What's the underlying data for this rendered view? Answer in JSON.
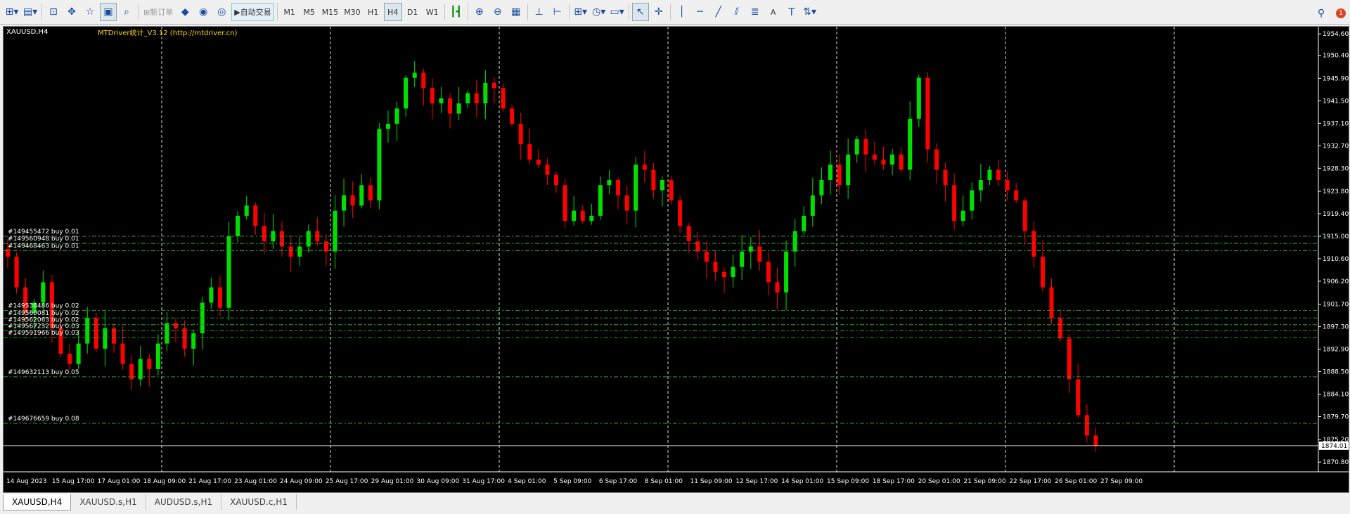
{
  "toolbar": {
    "new_order": "新订单",
    "auto_trading": "自动交易",
    "timeframes": [
      "M1",
      "M5",
      "M15",
      "M30",
      "H1",
      "H4",
      "D1",
      "W1"
    ],
    "active_timeframe": "H4",
    "text_tool": "A",
    "notification_count": "1"
  },
  "chart": {
    "symbol_label": "XAUUSD,H4",
    "indicator_label": "MTDriver统计_V3.12 (http://mtdriver.cn)",
    "current_price": "1874.01",
    "colors": {
      "bull": "#00e000",
      "bear": "#ff0000",
      "level": "#2aa02a",
      "grid": "#ffffff"
    }
  },
  "chart_data": {
    "type": "candlestick",
    "symbol": "XAUUSD",
    "timeframe": "H4",
    "price_axis": [
      "1954.60",
      "1950.40",
      "1945.90",
      "1941.50",
      "1937.10",
      "1932.70",
      "1928.30",
      "1923.80",
      "1919.40",
      "1915.00",
      "1910.60",
      "1906.20",
      "1901.70",
      "1897.30",
      "1892.90",
      "1888.50",
      "1884.10",
      "1879.70",
      "1875.20",
      "1870.80"
    ],
    "time_axis": [
      "14 Aug 2023",
      "15 Aug 17:00",
      "17 Aug 01:00",
      "18 Aug 09:00",
      "21 Aug 17:00",
      "23 Aug 01:00",
      "24 Aug 09:00",
      "25 Aug 17:00",
      "29 Aug 01:00",
      "30 Aug 09:00",
      "31 Aug 17:00",
      "4 Sep 01:00",
      "5 Sep 09:00",
      "6 Sep 17:00",
      "8 Sep 01:00",
      "11 Sep 09:00",
      "12 Sep 17:00",
      "14 Sep 01:00",
      "15 Sep 09:00",
      "18 Sep 17:00",
      "20 Sep 01:00",
      "21 Sep 09:00",
      "22 Sep 17:00",
      "26 Sep 01:00",
      "27 Sep 09:00"
    ],
    "ylim": [
      1870.0,
      1956.0
    ],
    "close_path": [
      1911,
      1905,
      1900,
      1902,
      1906,
      1897,
      1892,
      1890,
      1894,
      1899,
      1893,
      1897,
      1894,
      1890,
      1887,
      1891,
      1889,
      1894,
      1898,
      1897,
      1893,
      1896,
      1902,
      1905,
      1901,
      1915,
      1919,
      1921,
      1917,
      1914,
      1916,
      1913,
      1911,
      1913,
      1916,
      1914,
      1912,
      1920,
      1923,
      1921,
      1925,
      1922,
      1936,
      1937,
      1940,
      1946,
      1947,
      1944,
      1941,
      1942,
      1939,
      1941,
      1943,
      1941,
      1945,
      1944,
      1940,
      1937,
      1933,
      1930,
      1929,
      1927,
      1925,
      1918,
      1920,
      1918,
      1919,
      1925,
      1926,
      1923,
      1920,
      1929,
      1928,
      1924,
      1926,
      1922,
      1917,
      1914,
      1912,
      1910,
      1908,
      1907,
      1909,
      1912,
      1913,
      1910,
      1906,
      1904,
      1912,
      1916,
      1919,
      1923,
      1926,
      1929,
      1925,
      1931,
      1934,
      1931,
      1930,
      1929,
      1931,
      1928,
      1938,
      1946,
      1932,
      1928,
      1925,
      1918,
      1920,
      1924,
      1926,
      1928,
      1926,
      1924,
      1922,
      1916,
      1911,
      1905,
      1899,
      1895,
      1887,
      1880,
      1876,
      1874
    ],
    "orders": [
      {
        "label": "#149455472 buy 0.01",
        "price": 1915.0
      },
      {
        "label": "#149560948 buy 0.01",
        "price": 1913.6
      },
      {
        "label": "#149468463 buy 0.01",
        "price": 1912.2
      },
      {
        "label": "#149538486 buy 0.02",
        "price": 1900.5
      },
      {
        "label": "#149560081 buy 0.02",
        "price": 1899.0
      },
      {
        "label": "#149562063 buy 0.02",
        "price": 1897.7
      },
      {
        "label": "#149567252 buy 0.03",
        "price": 1896.5
      },
      {
        "label": "#149591966 buy 0.03",
        "price": 1895.2
      },
      {
        "label": "#149632113 buy 0.05",
        "price": 1887.5
      },
      {
        "label": "#149676659 buy 0.08",
        "price": 1878.4
      }
    ]
  },
  "tabs": [
    {
      "label": "XAUUSD,H4",
      "active": true
    },
    {
      "label": "XAUUSD.s,H1",
      "active": false
    },
    {
      "label": "AUDUSD.s,H1",
      "active": false
    },
    {
      "label": "XAUUSD.c,H1",
      "active": false
    }
  ]
}
